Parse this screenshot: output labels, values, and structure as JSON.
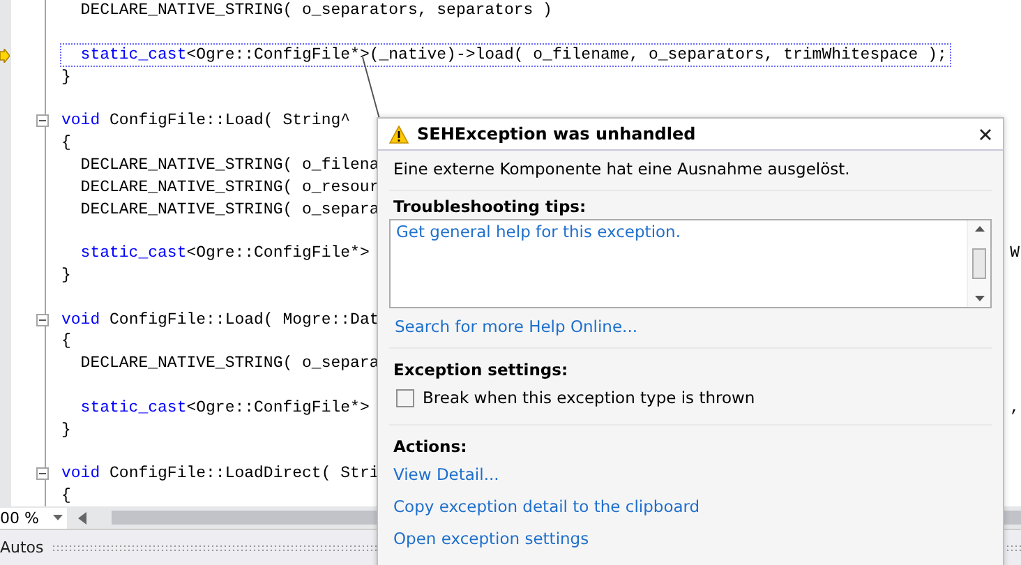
{
  "editor": {
    "lines": [
      {
        "kind": "code",
        "current": false,
        "collapsible": false,
        "parts": [
          {
            "kind": "plain",
            "text": "  DECLARE_NATIVE_STRING( o_separators, separators )"
          }
        ]
      },
      {
        "kind": "blank"
      },
      {
        "kind": "code",
        "current": true,
        "collapsible": false,
        "parts": [
          {
            "kind": "keyword",
            "text": "  static_cast"
          },
          {
            "kind": "plain",
            "text": "<Ogre::ConfigFile*>(_native)->load( o_filename, o_separators, trimWhitespace );"
          }
        ]
      },
      {
        "kind": "code",
        "current": false,
        "collapsible": false,
        "parts": [
          {
            "kind": "plain",
            "text": "}"
          }
        ]
      },
      {
        "kind": "blank"
      },
      {
        "kind": "code",
        "current": false,
        "collapsible": true,
        "parts": [
          {
            "kind": "keyword",
            "text": "void"
          },
          {
            "kind": "plain",
            "text": " ConfigFile::Load( String^"
          }
        ]
      },
      {
        "kind": "code",
        "current": false,
        "collapsible": false,
        "parts": [
          {
            "kind": "plain",
            "text": "{"
          }
        ]
      },
      {
        "kind": "code",
        "current": false,
        "collapsible": false,
        "parts": [
          {
            "kind": "plain",
            "text": "  DECLARE_NATIVE_STRING( o_filena"
          }
        ]
      },
      {
        "kind": "code",
        "current": false,
        "collapsible": false,
        "parts": [
          {
            "kind": "plain",
            "text": "  DECLARE_NATIVE_STRING( o_resour"
          }
        ]
      },
      {
        "kind": "code",
        "current": false,
        "collapsible": false,
        "parts": [
          {
            "kind": "plain",
            "text": "  DECLARE_NATIVE_STRING( o_separa"
          }
        ]
      },
      {
        "kind": "blank"
      },
      {
        "kind": "code",
        "current": false,
        "collapsible": false,
        "tail": "W",
        "parts": [
          {
            "kind": "keyword",
            "text": "  static_cast"
          },
          {
            "kind": "plain",
            "text": "<Ogre::ConfigFile*>"
          }
        ]
      },
      {
        "kind": "code",
        "current": false,
        "collapsible": false,
        "parts": [
          {
            "kind": "plain",
            "text": "}"
          }
        ]
      },
      {
        "kind": "blank"
      },
      {
        "kind": "code",
        "current": false,
        "collapsible": true,
        "parts": [
          {
            "kind": "keyword",
            "text": "void"
          },
          {
            "kind": "plain",
            "text": " ConfigFile::Load( Mogre::Dat"
          }
        ]
      },
      {
        "kind": "code",
        "current": false,
        "collapsible": false,
        "parts": [
          {
            "kind": "plain",
            "text": "{"
          }
        ]
      },
      {
        "kind": "code",
        "current": false,
        "collapsible": false,
        "parts": [
          {
            "kind": "plain",
            "text": "  DECLARE_NATIVE_STRING( o_separa"
          }
        ]
      },
      {
        "kind": "blank"
      },
      {
        "kind": "code",
        "current": false,
        "collapsible": false,
        "tail": ",",
        "parts": [
          {
            "kind": "keyword",
            "text": "  static_cast"
          },
          {
            "kind": "plain",
            "text": "<Ogre::ConfigFile*>"
          }
        ]
      },
      {
        "kind": "code",
        "current": false,
        "collapsible": false,
        "parts": [
          {
            "kind": "plain",
            "text": "}"
          }
        ]
      },
      {
        "kind": "blank"
      },
      {
        "kind": "code",
        "current": false,
        "collapsible": true,
        "parts": [
          {
            "kind": "keyword",
            "text": "void"
          },
          {
            "kind": "plain",
            "text": " ConfigFile::LoadDirect( Stri"
          }
        ]
      },
      {
        "kind": "code",
        "current": false,
        "collapsible": false,
        "parts": [
          {
            "kind": "plain",
            "text": "{"
          }
        ]
      }
    ],
    "zoom": "00 %"
  },
  "bottom_panel": {
    "title": "Autos"
  },
  "dialog": {
    "title": "SEHException was unhandled",
    "message": "Eine externe Komponente hat eine Ausnahme ausgelöst.",
    "troubleshooting": {
      "heading": "Troubleshooting tips:",
      "tips": [
        "Get general help for this exception."
      ],
      "search_link": "Search for more Help Online..."
    },
    "settings": {
      "heading": "Exception settings:",
      "checkbox": {
        "label": "Break when this exception type is thrown",
        "checked": false
      }
    },
    "actions": {
      "heading": "Actions:",
      "links": [
        "View Detail...",
        "Copy exception detail to the clipboard",
        "Open exception settings"
      ]
    }
  }
}
